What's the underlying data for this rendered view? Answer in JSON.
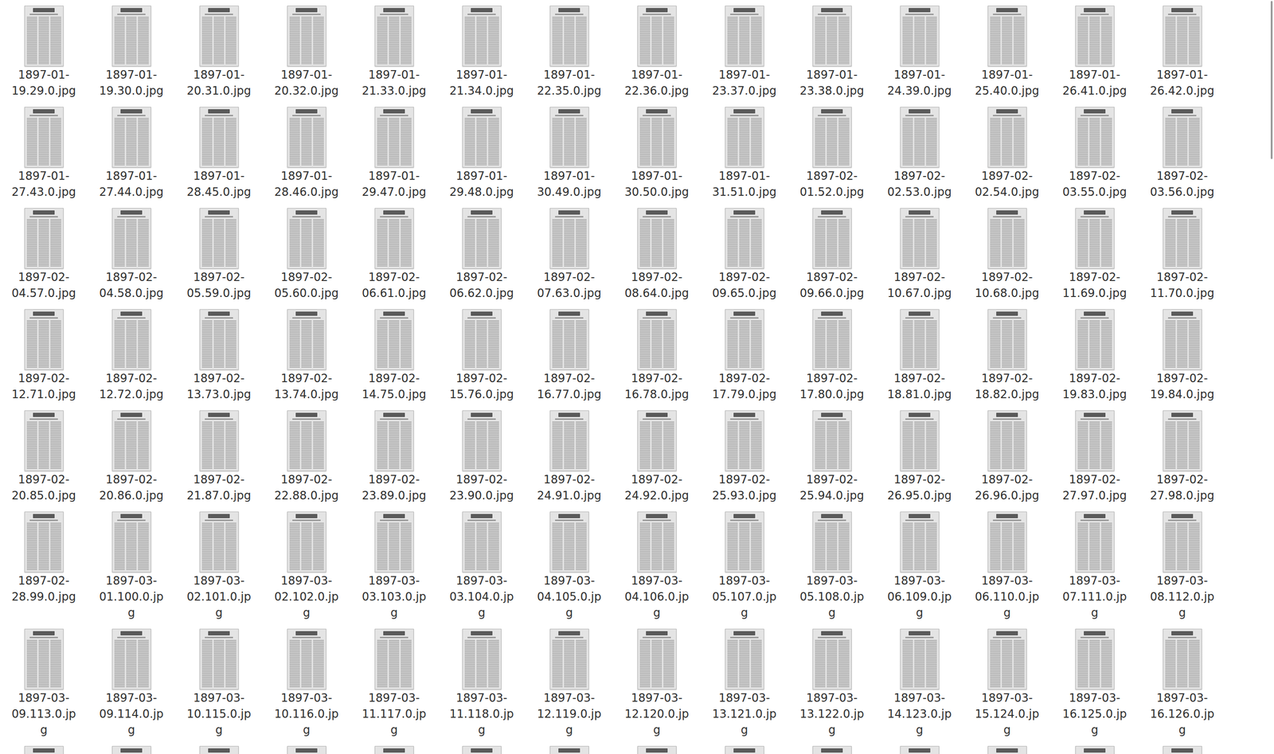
{
  "files": [
    "1897-01-19.29.0.jpg",
    "1897-01-19.30.0.jpg",
    "1897-01-20.31.0.jpg",
    "1897-01-20.32.0.jpg",
    "1897-01-21.33.0.jpg",
    "1897-01-21.34.0.jpg",
    "1897-01-22.35.0.jpg",
    "1897-01-22.36.0.jpg",
    "1897-01-23.37.0.jpg",
    "1897-01-23.38.0.jpg",
    "1897-01-24.39.0.jpg",
    "1897-01-25.40.0.jpg",
    "1897-01-26.41.0.jpg",
    "1897-01-26.42.0.jpg",
    "1897-01-27.43.0.jpg",
    "1897-01-27.44.0.jpg",
    "1897-01-28.45.0.jpg",
    "1897-01-28.46.0.jpg",
    "1897-01-29.47.0.jpg",
    "1897-01-29.48.0.jpg",
    "1897-01-30.49.0.jpg",
    "1897-01-30.50.0.jpg",
    "1897-01-31.51.0.jpg",
    "1897-02-01.52.0.jpg",
    "1897-02-02.53.0.jpg",
    "1897-02-02.54.0.jpg",
    "1897-02-03.55.0.jpg",
    "1897-02-03.56.0.jpg",
    "1897-02-04.57.0.jpg",
    "1897-02-04.58.0.jpg",
    "1897-02-05.59.0.jpg",
    "1897-02-05.60.0.jpg",
    "1897-02-06.61.0.jpg",
    "1897-02-06.62.0.jpg",
    "1897-02-07.63.0.jpg",
    "1897-02-08.64.0.jpg",
    "1897-02-09.65.0.jpg",
    "1897-02-09.66.0.jpg",
    "1897-02-10.67.0.jpg",
    "1897-02-10.68.0.jpg",
    "1897-02-11.69.0.jpg",
    "1897-02-11.70.0.jpg",
    "1897-02-12.71.0.jpg",
    "1897-02-12.72.0.jpg",
    "1897-02-13.73.0.jpg",
    "1897-02-13.74.0.jpg",
    "1897-02-14.75.0.jpg",
    "1897-02-15.76.0.jpg",
    "1897-02-16.77.0.jpg",
    "1897-02-16.78.0.jpg",
    "1897-02-17.79.0.jpg",
    "1897-02-17.80.0.jpg",
    "1897-02-18.81.0.jpg",
    "1897-02-18.82.0.jpg",
    "1897-02-19.83.0.jpg",
    "1897-02-19.84.0.jpg",
    "1897-02-20.85.0.jpg",
    "1897-02-20.86.0.jpg",
    "1897-02-21.87.0.jpg",
    "1897-02-22.88.0.jpg",
    "1897-02-23.89.0.jpg",
    "1897-02-23.90.0.jpg",
    "1897-02-24.91.0.jpg",
    "1897-02-24.92.0.jpg",
    "1897-02-25.93.0.jpg",
    "1897-02-25.94.0.jpg",
    "1897-02-26.95.0.jpg",
    "1897-02-26.96.0.jpg",
    "1897-02-27.97.0.jpg",
    "1897-02-27.98.0.jpg",
    "1897-02-28.99.0.jpg",
    "1897-03-01.100.0.jpg",
    "1897-03-02.101.0.jpg",
    "1897-03-02.102.0.jpg",
    "1897-03-03.103.0.jpg",
    "1897-03-03.104.0.jpg",
    "1897-03-04.105.0.jpg",
    "1897-03-04.106.0.jpg",
    "1897-03-05.107.0.jpg",
    "1897-03-05.108.0.jpg",
    "1897-03-06.109.0.jpg",
    "1897-03-06.110.0.jpg",
    "1897-03-07.111.0.jpg",
    "1897-03-08.112.0.jpg",
    "1897-03-09.113.0.jpg",
    "1897-03-09.114.0.jpg",
    "1897-03-10.115.0.jpg",
    "1897-03-10.116.0.jpg",
    "1897-03-11.117.0.jpg",
    "1897-03-11.118.0.jpg",
    "1897-03-12.119.0.jpg",
    "1897-03-12.120.0.jpg",
    "1897-03-13.121.0.jpg",
    "1897-03-13.122.0.jpg",
    "1897-03-14.123.0.jpg",
    "1897-03-15.124.0.jpg",
    "1897-03-16.125.0.jpg",
    "1897-03-16.126.0.jpg",
    "",
    "",
    "",
    "",
    "",
    "",
    "",
    "",
    "",
    "",
    "",
    "",
    "",
    ""
  ],
  "scrollbar": {
    "level": 0.21
  }
}
